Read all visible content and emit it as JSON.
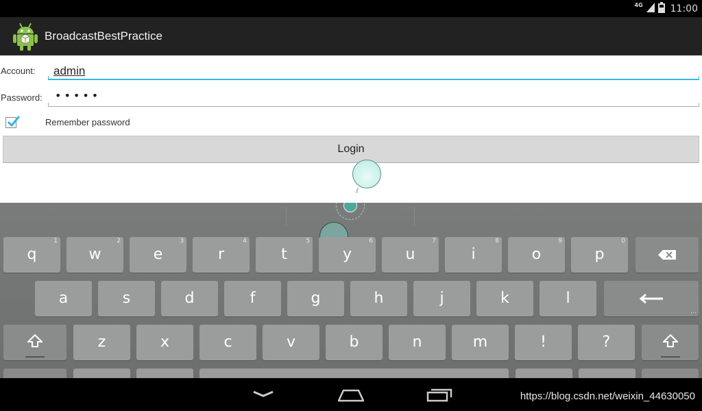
{
  "status_bar": {
    "network": "4G",
    "time": "11:00"
  },
  "action_bar": {
    "title": "BroadcastBestPractice",
    "icon": "android-robot-icon"
  },
  "form": {
    "account_label": "Account:",
    "account_value": "admin",
    "password_label": "Password:",
    "password_value": "•••••",
    "remember_label": "Remember password",
    "remember_checked": true,
    "login_label": "Login",
    "accent_color": "#33b5e5"
  },
  "keyboard": {
    "row1": [
      {
        "k": "q",
        "h": "1"
      },
      {
        "k": "w",
        "h": "2"
      },
      {
        "k": "e",
        "h": "3"
      },
      {
        "k": "r",
        "h": "4"
      },
      {
        "k": "t",
        "h": "5"
      },
      {
        "k": "y",
        "h": "6"
      },
      {
        "k": "u",
        "h": "7"
      },
      {
        "k": "i",
        "h": "8"
      },
      {
        "k": "o",
        "h": "9"
      },
      {
        "k": "p",
        "h": "0"
      }
    ],
    "row2": [
      "a",
      "s",
      "d",
      "f",
      "g",
      "h",
      "j",
      "k",
      "l"
    ],
    "row3": [
      "z",
      "x",
      "c",
      "v",
      "b",
      "n",
      "m",
      "!",
      "?"
    ],
    "backspace_icon": "backspace-icon",
    "enter_icon": "enter-arrow-icon",
    "shift_icon": "shift-icon"
  },
  "nav_bar": {
    "back_icon": "back-icon",
    "home_icon": "home-icon",
    "recents_icon": "recents-icon",
    "watermark": "https://blog.csdn.net/weixin_44630050"
  }
}
